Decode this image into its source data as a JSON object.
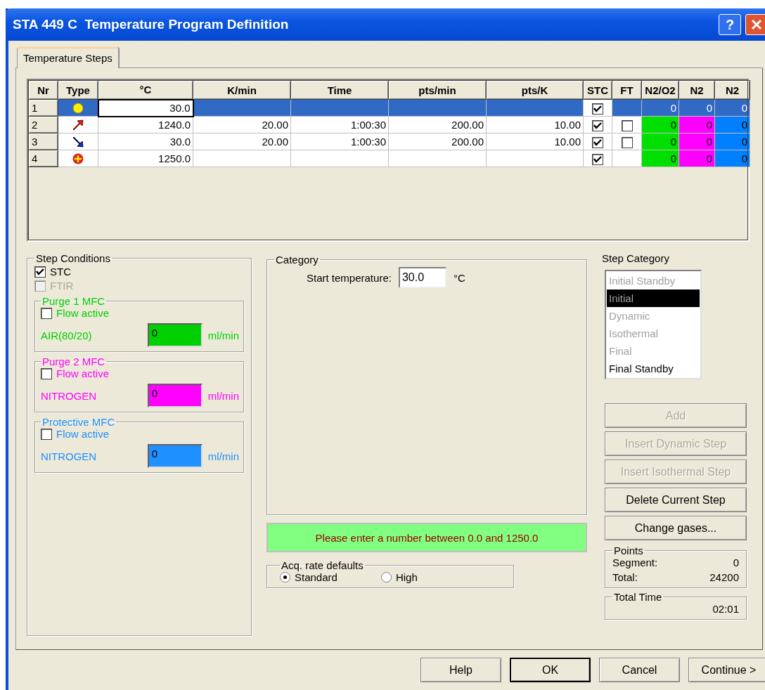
{
  "window": {
    "title": "STA 449 C  Temperature Program Definition",
    "help_glyph": "?"
  },
  "tabs": [
    {
      "label": "Temperature Steps",
      "selected": true
    }
  ],
  "table": {
    "columns": [
      {
        "label": "Nr"
      },
      {
        "label": "Type"
      },
      {
        "label": "°C"
      },
      {
        "label": "K/min"
      },
      {
        "label": "Time"
      },
      {
        "label": "pts/min"
      },
      {
        "label": "pts/K"
      },
      {
        "label": "STC"
      },
      {
        "label": "FT"
      },
      {
        "label": "N2/O2",
        "color": "#00e000"
      },
      {
        "label": "N2",
        "color": "#ff00ff"
      },
      {
        "label": "N2",
        "color": "#0080ff"
      }
    ],
    "rows": [
      {
        "nr": "1",
        "kind": "initial",
        "selected": true,
        "temp": "30.0",
        "stc_checked": true,
        "gases": [
          "0",
          "0",
          "0"
        ]
      },
      {
        "nr": "2",
        "kind": "heating",
        "selected": false,
        "temp": "1240.0",
        "rate": "20.00",
        "time": "1:00:30",
        "pts_min": "200.00",
        "pts_k": "10.00",
        "stc_checked": true,
        "ft_checked": false,
        "gases": [
          "0",
          "0",
          "0"
        ]
      },
      {
        "nr": "3",
        "kind": "cooling",
        "selected": false,
        "temp": "30.0",
        "rate": "20.00",
        "time": "1:00:30",
        "pts_min": "200.00",
        "pts_k": "10.00",
        "stc_checked": true,
        "ft_checked": false,
        "gases": [
          "0",
          "0",
          "0"
        ]
      },
      {
        "nr": "4",
        "kind": "final",
        "selected": false,
        "temp": "1250.0",
        "stc_checked": true,
        "gases": [
          "0",
          "0",
          "0"
        ]
      }
    ]
  },
  "step_conditions": {
    "title": "Step Conditions",
    "options": [
      {
        "label": "STC",
        "checked": true,
        "disabled": false
      },
      {
        "label": "FTIR",
        "checked": false,
        "disabled": true
      }
    ],
    "mfcs": [
      {
        "title": "Purge 1 MFC",
        "color": "#00d000",
        "flow_label": "Flow active",
        "flow_active": false,
        "gas": "AIR(80/20)",
        "value": "0",
        "unit": "ml/min"
      },
      {
        "title": "Purge 2 MFC",
        "color": "#ff00ff",
        "flow_label": "Flow active",
        "flow_active": false,
        "gas": "NITROGEN",
        "value": "0",
        "unit": "ml/min"
      },
      {
        "title": "Protective MFC",
        "color": "#1e90ff",
        "flow_label": "Flow active",
        "flow_active": false,
        "gas": "NITROGEN",
        "value": "0",
        "unit": "ml/min"
      }
    ]
  },
  "category": {
    "title": "Category",
    "field_label": "Start temperature:",
    "value": "30.0",
    "unit": "°C"
  },
  "message": "Please enter a number between 0.0 and 1250.0",
  "acq_rate": {
    "title": "Acq. rate defaults",
    "options": [
      {
        "label": "Standard",
        "selected": true
      },
      {
        "label": "High",
        "selected": false
      }
    ]
  },
  "step_category": {
    "label": "Step Category",
    "items": [
      {
        "label": "Initial Standby",
        "disabled": true,
        "selected": false
      },
      {
        "label": "Initial",
        "disabled": true,
        "selected": true
      },
      {
        "label": "Dynamic",
        "disabled": true,
        "selected": false
      },
      {
        "label": "Isothermal",
        "disabled": true,
        "selected": false
      },
      {
        "label": "Final",
        "disabled": true,
        "selected": false
      },
      {
        "label": "Final Standby",
        "disabled": false,
        "selected": false
      }
    ]
  },
  "actions": [
    {
      "label": "Add",
      "disabled": true
    },
    {
      "label": "Insert Dynamic Step",
      "disabled": true
    },
    {
      "label": "Insert Isothermal Step",
      "disabled": true
    },
    {
      "label": "Delete Current Step",
      "disabled": false
    },
    {
      "label": "Change gases...",
      "disabled": false
    }
  ],
  "points": {
    "title": "Points",
    "rows": [
      {
        "label": "Segment:",
        "value": "0"
      },
      {
        "label": "Total:",
        "value": "24200"
      }
    ]
  },
  "total_time": {
    "title": "Total Time",
    "value": "02:01"
  },
  "footer_buttons": [
    {
      "label": "Help",
      "default": false
    },
    {
      "label": "OK",
      "default": true
    },
    {
      "label": "Cancel",
      "default": false
    },
    {
      "label": "Continue >",
      "default": false
    }
  ]
}
